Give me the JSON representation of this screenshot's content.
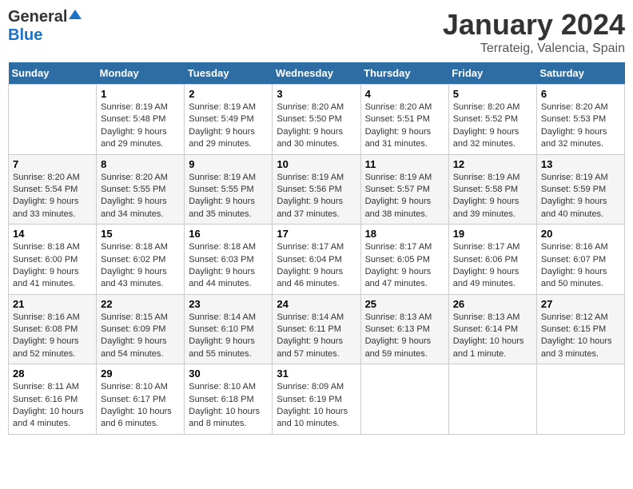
{
  "header": {
    "logo_general": "General",
    "logo_blue": "Blue",
    "month_title": "January 2024",
    "location": "Terrateig, Valencia, Spain"
  },
  "weekdays": [
    "Sunday",
    "Monday",
    "Tuesday",
    "Wednesday",
    "Thursday",
    "Friday",
    "Saturday"
  ],
  "weeks": [
    [
      {
        "day": "",
        "info": ""
      },
      {
        "day": "1",
        "info": "Sunrise: 8:19 AM\nSunset: 5:48 PM\nDaylight: 9 hours\nand 29 minutes."
      },
      {
        "day": "2",
        "info": "Sunrise: 8:19 AM\nSunset: 5:49 PM\nDaylight: 9 hours\nand 29 minutes."
      },
      {
        "day": "3",
        "info": "Sunrise: 8:20 AM\nSunset: 5:50 PM\nDaylight: 9 hours\nand 30 minutes."
      },
      {
        "day": "4",
        "info": "Sunrise: 8:20 AM\nSunset: 5:51 PM\nDaylight: 9 hours\nand 31 minutes."
      },
      {
        "day": "5",
        "info": "Sunrise: 8:20 AM\nSunset: 5:52 PM\nDaylight: 9 hours\nand 32 minutes."
      },
      {
        "day": "6",
        "info": "Sunrise: 8:20 AM\nSunset: 5:53 PM\nDaylight: 9 hours\nand 32 minutes."
      }
    ],
    [
      {
        "day": "7",
        "info": "Sunrise: 8:20 AM\nSunset: 5:54 PM\nDaylight: 9 hours\nand 33 minutes."
      },
      {
        "day": "8",
        "info": "Sunrise: 8:20 AM\nSunset: 5:55 PM\nDaylight: 9 hours\nand 34 minutes."
      },
      {
        "day": "9",
        "info": "Sunrise: 8:19 AM\nSunset: 5:55 PM\nDaylight: 9 hours\nand 35 minutes."
      },
      {
        "day": "10",
        "info": "Sunrise: 8:19 AM\nSunset: 5:56 PM\nDaylight: 9 hours\nand 37 minutes."
      },
      {
        "day": "11",
        "info": "Sunrise: 8:19 AM\nSunset: 5:57 PM\nDaylight: 9 hours\nand 38 minutes."
      },
      {
        "day": "12",
        "info": "Sunrise: 8:19 AM\nSunset: 5:58 PM\nDaylight: 9 hours\nand 39 minutes."
      },
      {
        "day": "13",
        "info": "Sunrise: 8:19 AM\nSunset: 5:59 PM\nDaylight: 9 hours\nand 40 minutes."
      }
    ],
    [
      {
        "day": "14",
        "info": "Sunrise: 8:18 AM\nSunset: 6:00 PM\nDaylight: 9 hours\nand 41 minutes."
      },
      {
        "day": "15",
        "info": "Sunrise: 8:18 AM\nSunset: 6:02 PM\nDaylight: 9 hours\nand 43 minutes."
      },
      {
        "day": "16",
        "info": "Sunrise: 8:18 AM\nSunset: 6:03 PM\nDaylight: 9 hours\nand 44 minutes."
      },
      {
        "day": "17",
        "info": "Sunrise: 8:17 AM\nSunset: 6:04 PM\nDaylight: 9 hours\nand 46 minutes."
      },
      {
        "day": "18",
        "info": "Sunrise: 8:17 AM\nSunset: 6:05 PM\nDaylight: 9 hours\nand 47 minutes."
      },
      {
        "day": "19",
        "info": "Sunrise: 8:17 AM\nSunset: 6:06 PM\nDaylight: 9 hours\nand 49 minutes."
      },
      {
        "day": "20",
        "info": "Sunrise: 8:16 AM\nSunset: 6:07 PM\nDaylight: 9 hours\nand 50 minutes."
      }
    ],
    [
      {
        "day": "21",
        "info": "Sunrise: 8:16 AM\nSunset: 6:08 PM\nDaylight: 9 hours\nand 52 minutes."
      },
      {
        "day": "22",
        "info": "Sunrise: 8:15 AM\nSunset: 6:09 PM\nDaylight: 9 hours\nand 54 minutes."
      },
      {
        "day": "23",
        "info": "Sunrise: 8:14 AM\nSunset: 6:10 PM\nDaylight: 9 hours\nand 55 minutes."
      },
      {
        "day": "24",
        "info": "Sunrise: 8:14 AM\nSunset: 6:11 PM\nDaylight: 9 hours\nand 57 minutes."
      },
      {
        "day": "25",
        "info": "Sunrise: 8:13 AM\nSunset: 6:13 PM\nDaylight: 9 hours\nand 59 minutes."
      },
      {
        "day": "26",
        "info": "Sunrise: 8:13 AM\nSunset: 6:14 PM\nDaylight: 10 hours\nand 1 minute."
      },
      {
        "day": "27",
        "info": "Sunrise: 8:12 AM\nSunset: 6:15 PM\nDaylight: 10 hours\nand 3 minutes."
      }
    ],
    [
      {
        "day": "28",
        "info": "Sunrise: 8:11 AM\nSunset: 6:16 PM\nDaylight: 10 hours\nand 4 minutes."
      },
      {
        "day": "29",
        "info": "Sunrise: 8:10 AM\nSunset: 6:17 PM\nDaylight: 10 hours\nand 6 minutes."
      },
      {
        "day": "30",
        "info": "Sunrise: 8:10 AM\nSunset: 6:18 PM\nDaylight: 10 hours\nand 8 minutes."
      },
      {
        "day": "31",
        "info": "Sunrise: 8:09 AM\nSunset: 6:19 PM\nDaylight: 10 hours\nand 10 minutes."
      },
      {
        "day": "",
        "info": ""
      },
      {
        "day": "",
        "info": ""
      },
      {
        "day": "",
        "info": ""
      }
    ]
  ]
}
